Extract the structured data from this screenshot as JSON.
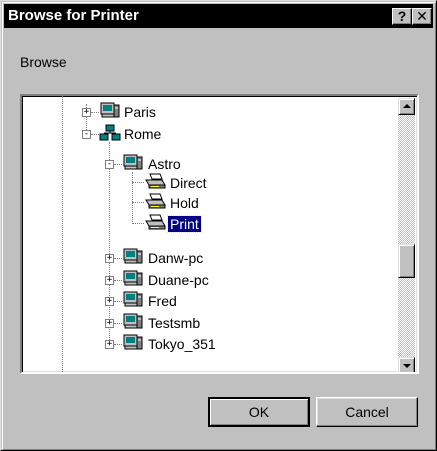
{
  "window": {
    "title": "Browse for Printer",
    "help_label": "?",
    "close_label": "✕"
  },
  "dialog": {
    "browse_label": "Browse",
    "ok_label": "OK",
    "cancel_label": "Cancel"
  },
  "tree": {
    "nodes": [
      {
        "label": "Paris",
        "icon": "computer-icon",
        "expander": "+"
      },
      {
        "label": "Rome",
        "icon": "network-icon",
        "expander": "-"
      },
      {
        "label": "Astro",
        "icon": "computer-icon",
        "expander": "-"
      },
      {
        "label": "Direct",
        "icon": "printer-icon"
      },
      {
        "label": "Hold",
        "icon": "printer-icon"
      },
      {
        "label": "Print",
        "icon": "printer-icon",
        "selected": true
      },
      {
        "label": "Danw-pc",
        "icon": "computer-icon",
        "expander": "+"
      },
      {
        "label": "Duane-pc",
        "icon": "computer-icon",
        "expander": "+"
      },
      {
        "label": "Fred",
        "icon": "computer-icon",
        "expander": "+"
      },
      {
        "label": "Testsmb",
        "icon": "computer-icon",
        "expander": "+"
      },
      {
        "label": "Tokyo_351",
        "icon": "computer-icon",
        "expander": "+"
      }
    ]
  },
  "colors": {
    "face": "#c0c0c0",
    "titlebar": "#000000",
    "selection": "#000080"
  }
}
